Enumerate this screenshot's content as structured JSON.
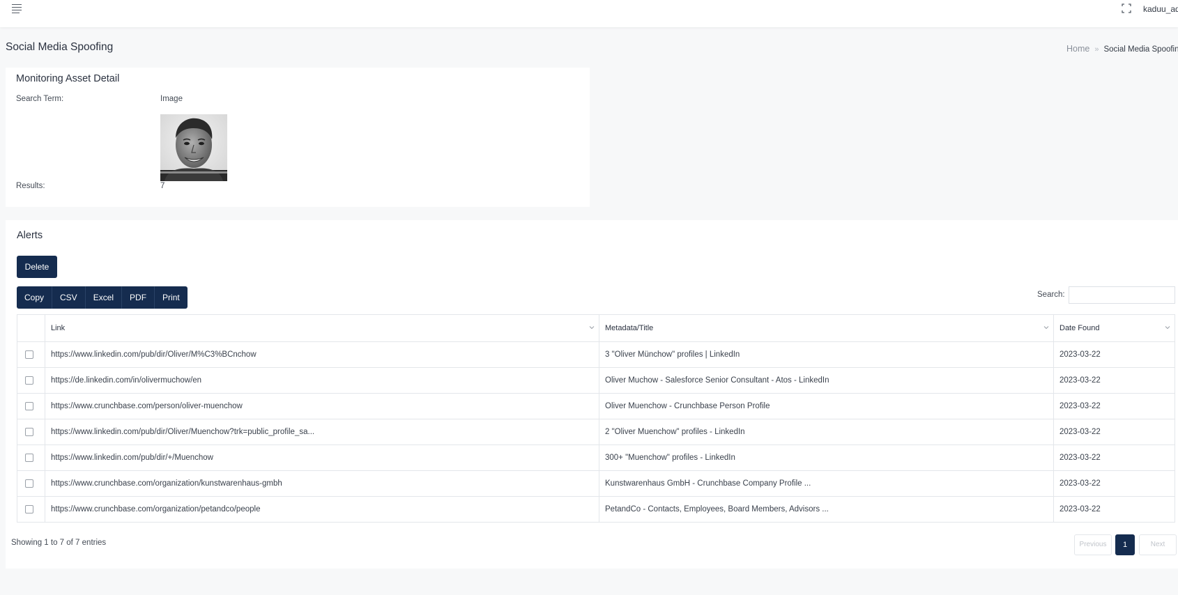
{
  "header": {
    "username": "kaduu_ad",
    "icons": {
      "menu": "hamburger-menu-icon",
      "fullscreen": "fullscreen-icon"
    }
  },
  "page": {
    "title": "Social Media Spoofing",
    "breadcrumb": {
      "home": "Home",
      "separator": "»",
      "current": "Social Media Spoofing"
    }
  },
  "asset_detail": {
    "title": "Monitoring Asset Detail",
    "search_term_label": "Search Term:",
    "search_term_value": "Image",
    "results_label": "Results:",
    "results_value": "7"
  },
  "alerts": {
    "title": "Alerts",
    "delete_label": "Delete",
    "export_buttons": [
      "Copy",
      "CSV",
      "Excel",
      "PDF",
      "Print"
    ],
    "search_label": "Search:",
    "search_value": "",
    "columns": [
      "Link",
      "Metadata/Title",
      "Date Found"
    ],
    "rows": [
      {
        "link": "https://www.linkedin.com/pub/dir/Oliver/M%C3%BCnchow",
        "title": "3 \"Oliver Münchow\" profiles | LinkedIn",
        "date": "2023-03-22"
      },
      {
        "link": "https://de.linkedin.com/in/olivermuchow/en",
        "title": "Oliver Muchow - Salesforce Senior Consultant - Atos - LinkedIn",
        "date": "2023-03-22"
      },
      {
        "link": "https://www.crunchbase.com/person/oliver-muenchow",
        "title": "Oliver Muenchow - Crunchbase Person Profile",
        "date": "2023-03-22"
      },
      {
        "link": "https://www.linkedin.com/pub/dir/Oliver/Muenchow?trk=public_profile_sa...",
        "title": "2 \"Oliver Muenchow\" profiles - LinkedIn",
        "date": "2023-03-22"
      },
      {
        "link": "https://www.linkedin.com/pub/dir/+/Muenchow",
        "title": "300+ \"Muenchow\" profiles - LinkedIn",
        "date": "2023-03-22"
      },
      {
        "link": "https://www.crunchbase.com/organization/kunstwarenhaus-gmbh",
        "title": "Kunstwarenhaus GmbH - Crunchbase Company Profile ...",
        "date": "2023-03-22"
      },
      {
        "link": "https://www.crunchbase.com/organization/petandco/people",
        "title": "PetandCo - Contacts, Employees, Board Members, Advisors ...",
        "date": "2023-03-22"
      }
    ],
    "info": "Showing 1 to 7 of 7 entries",
    "pagination": {
      "previous": "Previous",
      "current": "1",
      "next": "Next"
    }
  },
  "colors": {
    "primary": "#152c4f",
    "background": "#f7f8f9",
    "card": "#ffffff",
    "border": "#e3e6ea"
  }
}
